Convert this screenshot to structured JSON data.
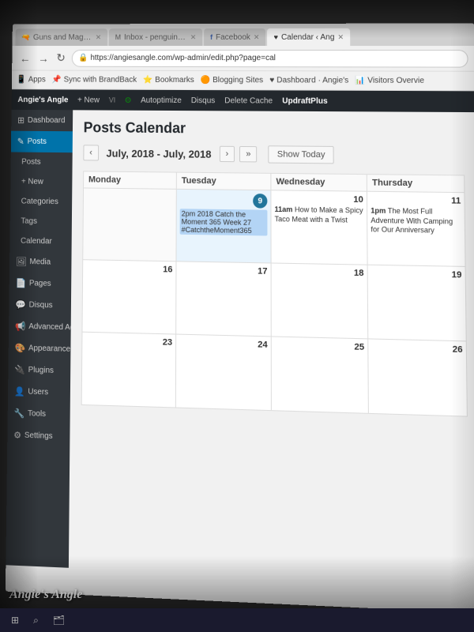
{
  "browser": {
    "tabs": [
      {
        "label": "Guns and Magic on Face...",
        "active": false
      },
      {
        "label": "M Inbox - penguinsangel@...",
        "active": false
      },
      {
        "label": "Facebook",
        "active": false
      },
      {
        "label": "Calendar ‹ Ang",
        "active": true
      }
    ],
    "url": "https://angiesangle.com/wp-admin/edit.php?page=cal",
    "url_prefix": "Secure",
    "bookmarks": [
      "Apps",
      "Sync with BrandBack",
      "Bookmarks",
      "Blogging Sites",
      "Dashboard · Angie's",
      "Visitors Overvie"
    ]
  },
  "wp_admin_bar": {
    "site_name": "Angie's Angle",
    "items": [
      "+ New",
      "Autoptimize",
      "Disqus",
      "Delete Cache",
      "UpdraftPlus"
    ]
  },
  "sidebar": {
    "items": [
      {
        "label": "Dashboard",
        "icon": "⊞",
        "active": false
      },
      {
        "label": "Posts",
        "icon": "✎",
        "active": true
      },
      {
        "label": "Posts",
        "icon": "✎",
        "active": false
      },
      {
        "label": "+ New",
        "icon": "+",
        "active": false
      },
      {
        "label": "Categories",
        "icon": "◈",
        "active": false
      },
      {
        "label": "Tags",
        "icon": "⌗",
        "active": false
      },
      {
        "label": "Calendar",
        "icon": "📅",
        "active": false
      },
      {
        "label": "Media",
        "icon": "🖼",
        "active": false
      },
      {
        "label": "Pages",
        "icon": "📄",
        "active": false
      },
      {
        "label": "Disqus",
        "icon": "💬",
        "active": false
      },
      {
        "label": "Advanced Ads",
        "icon": "📢",
        "active": false
      },
      {
        "label": "Appearance",
        "icon": "🎨",
        "active": false
      },
      {
        "label": "Plugins",
        "icon": "🔌",
        "active": false
      },
      {
        "label": "Users",
        "icon": "👤",
        "active": false
      },
      {
        "label": "Tools",
        "icon": "🔧",
        "active": false
      },
      {
        "label": "Settings",
        "icon": "⚙",
        "active": false
      }
    ]
  },
  "page": {
    "title": "Posts Calendar",
    "calendar": {
      "range": "July, 2018 - July, 2018",
      "show_today": "Show Today",
      "columns": [
        "Monday",
        "Tuesday",
        "Wednesday",
        "Thursday"
      ],
      "weeks": [
        {
          "monday": {
            "day": null
          },
          "tuesday": {
            "day": 9,
            "today": true,
            "events": [
              {
                "time": "2pm",
                "title": "2018 Catch the Moment 365 Week 27 #CatchtheMoment365"
              }
            ]
          },
          "wednesday": {
            "day": 10,
            "events": [
              {
                "time": "11am",
                "title": "How to Make a Spicy Taco Meat with a Twist"
              }
            ]
          },
          "thursday": {
            "day": 11,
            "events": [
              {
                "time": "1pm",
                "title": "The Most Full Adventure With Camping for Our Anniversary"
              }
            ]
          }
        },
        {
          "monday": {
            "day": 16
          },
          "tuesday": {
            "day": 17
          },
          "wednesday": {
            "day": 18
          },
          "thursday": {
            "day": 19
          }
        },
        {
          "monday": {
            "day": 23
          },
          "tuesday": {
            "day": 24
          },
          "wednesday": {
            "day": 25
          },
          "thursday": {
            "day": 26
          }
        }
      ]
    }
  },
  "watermark": "Angie's Angle",
  "taskbar": {
    "items": [
      "⊞",
      "⌕",
      "🗂"
    ]
  }
}
